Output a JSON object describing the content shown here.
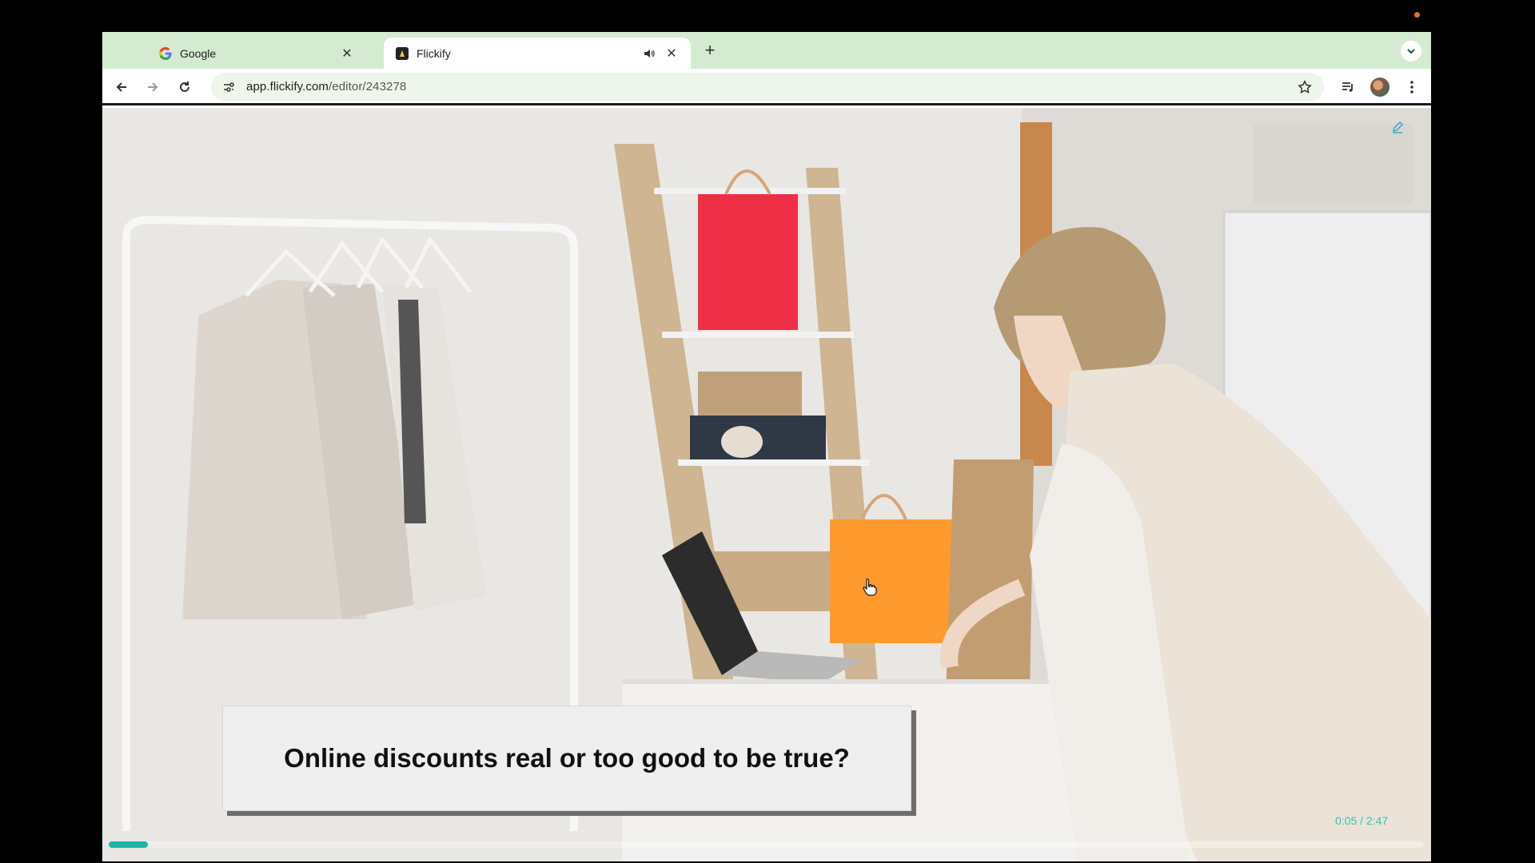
{
  "browser": {
    "tabs": [
      {
        "title": "Google",
        "active": false,
        "icon": "google-icon"
      },
      {
        "title": "Flickify",
        "active": true,
        "icon": "flickify-icon",
        "audio": true
      }
    ],
    "url": {
      "domain": "app.flickify.com",
      "path": "/editor/243278"
    }
  },
  "video": {
    "caption": "Online discounts real or too good to be true?",
    "timecode": "0:05 / 2:47",
    "progress_fraction": 0.03,
    "colors": {
      "accent": "#1ab5a6",
      "timecode": "#2cc5b5"
    }
  }
}
